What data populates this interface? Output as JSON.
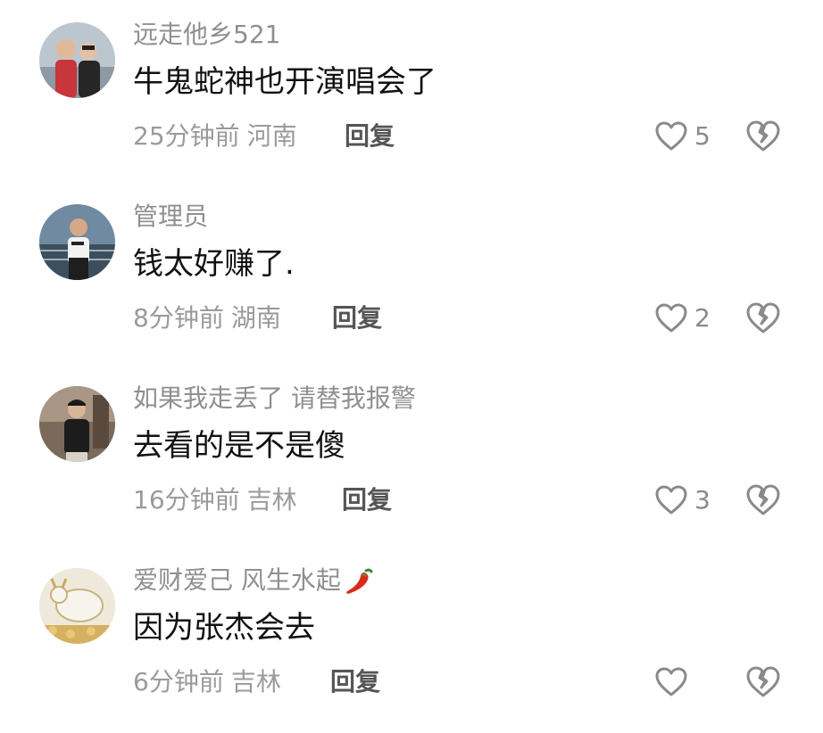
{
  "comments": [
    {
      "username": "远走他乡521",
      "text": "牛鬼蛇神也开演唱会了",
      "time": "25分钟前",
      "location": "河南",
      "reply_label": "回复",
      "likes": "5"
    },
    {
      "username": "管理员",
      "text": "钱太好赚了.",
      "time": "8分钟前",
      "location": "湖南",
      "reply_label": "回复",
      "likes": "2"
    },
    {
      "username": "如果我走丢了 请替我报警",
      "text": "去看的是不是傻",
      "time": "16分钟前",
      "location": "吉林",
      "reply_label": "回复",
      "likes": "3"
    },
    {
      "username": "爱财爱己 风生水起",
      "username_emoji": "chili-pepper-icon",
      "text": "因为张杰会去",
      "time": "6分钟前",
      "location": "吉林",
      "reply_label": "回复",
      "likes": ""
    }
  ],
  "colors": {
    "username": "#8f8f8f",
    "content": "#111111",
    "meta": "#9a9a9a",
    "reply": "#555555",
    "icon": "#8a8a8a"
  }
}
